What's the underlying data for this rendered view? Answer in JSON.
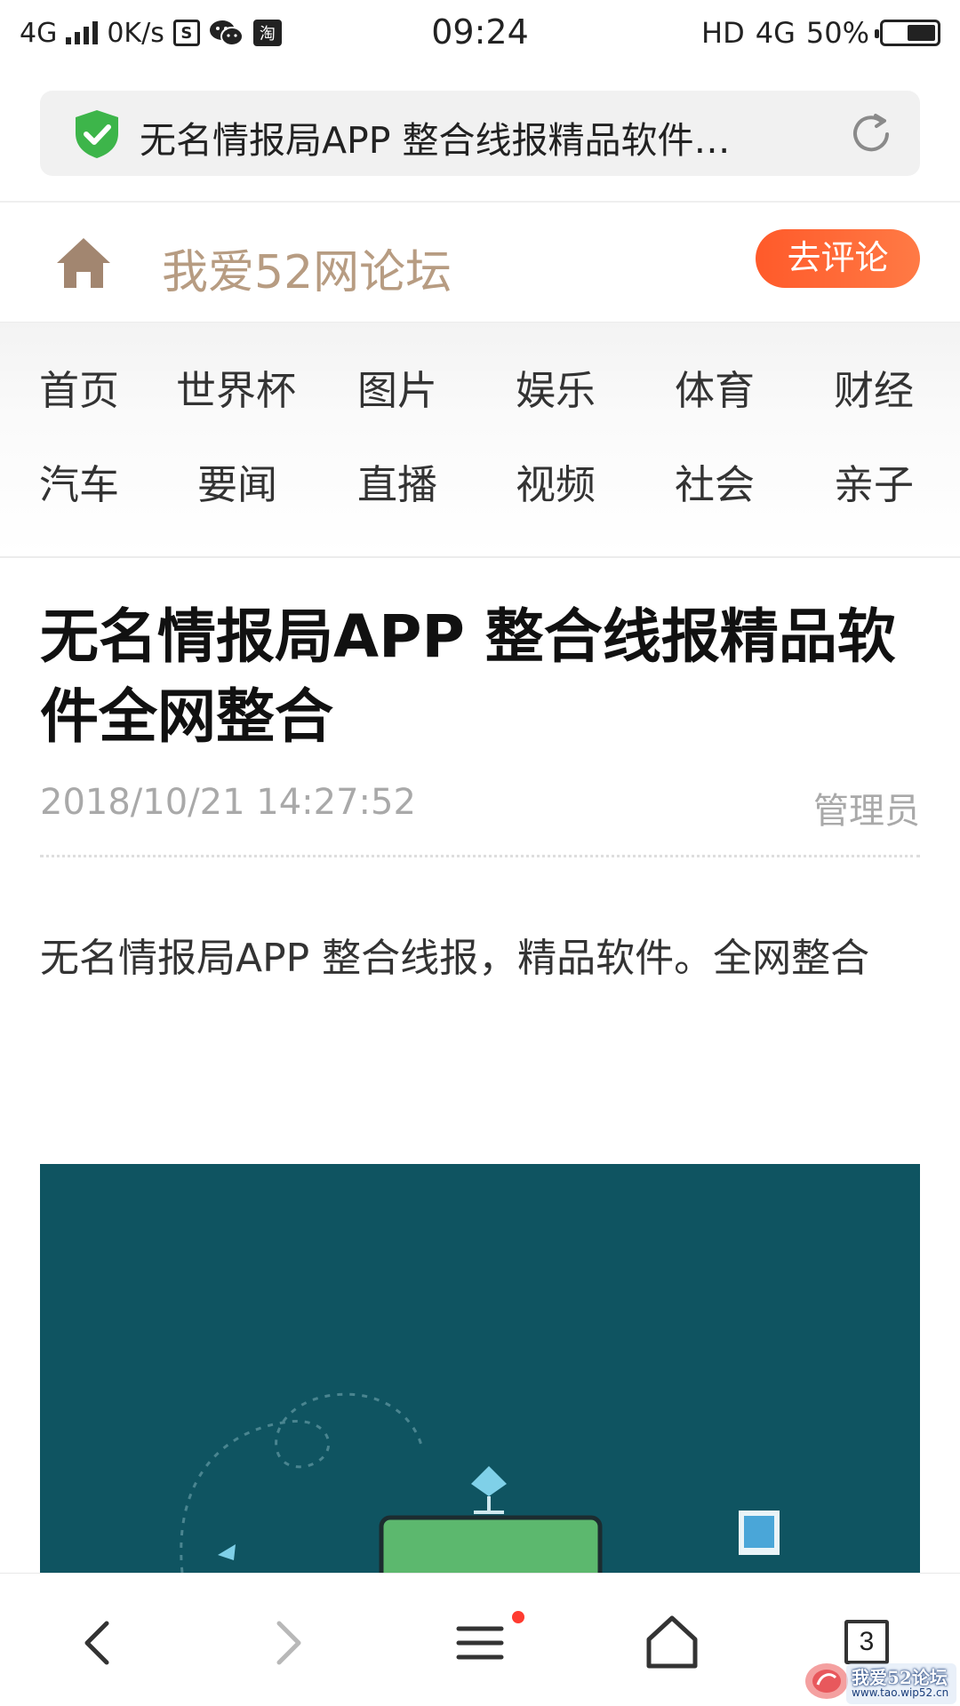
{
  "status_bar": {
    "network": "4G",
    "speed": "0K/s",
    "app_icon_1": "S",
    "app_icon_3": "淘",
    "time": "09:24",
    "hd": "HD",
    "network_right": "4G",
    "battery": "50%"
  },
  "address_bar": {
    "title": "无名情报局APP 整合线报精品软件…",
    "secure_icon": "shield-check-icon",
    "reload_icon": "reload-icon"
  },
  "site_header": {
    "site_name": "我爱52网论坛",
    "comment_button": "去评论",
    "home_icon": "home-icon"
  },
  "nav": {
    "row1": [
      "首页",
      "世界杯",
      "图片",
      "娱乐",
      "体育",
      "财经"
    ],
    "row2": [
      "汽车",
      "要闻",
      "直播",
      "视频",
      "社会",
      "亲子"
    ]
  },
  "article": {
    "title": "无名情报局APP 整合线报精品软件全网整合",
    "date": "2018/10/21 14:27:52",
    "author": "管理员",
    "body": "无名情报局APP 整合线报，精品软件。全网整合"
  },
  "toolbar": {
    "tab_count": "3",
    "icons": [
      "back-icon",
      "forward-icon",
      "menu-icon",
      "home-icon",
      "tabs-icon"
    ]
  },
  "watermark": {
    "text": "我爱52论坛",
    "url": "www.tao.wip52.cn"
  },
  "colors": {
    "accent": "#ff5a2a",
    "site_name": "#b79c82",
    "secure_green": "#3db54a",
    "hero_bg": "#0f5461"
  }
}
